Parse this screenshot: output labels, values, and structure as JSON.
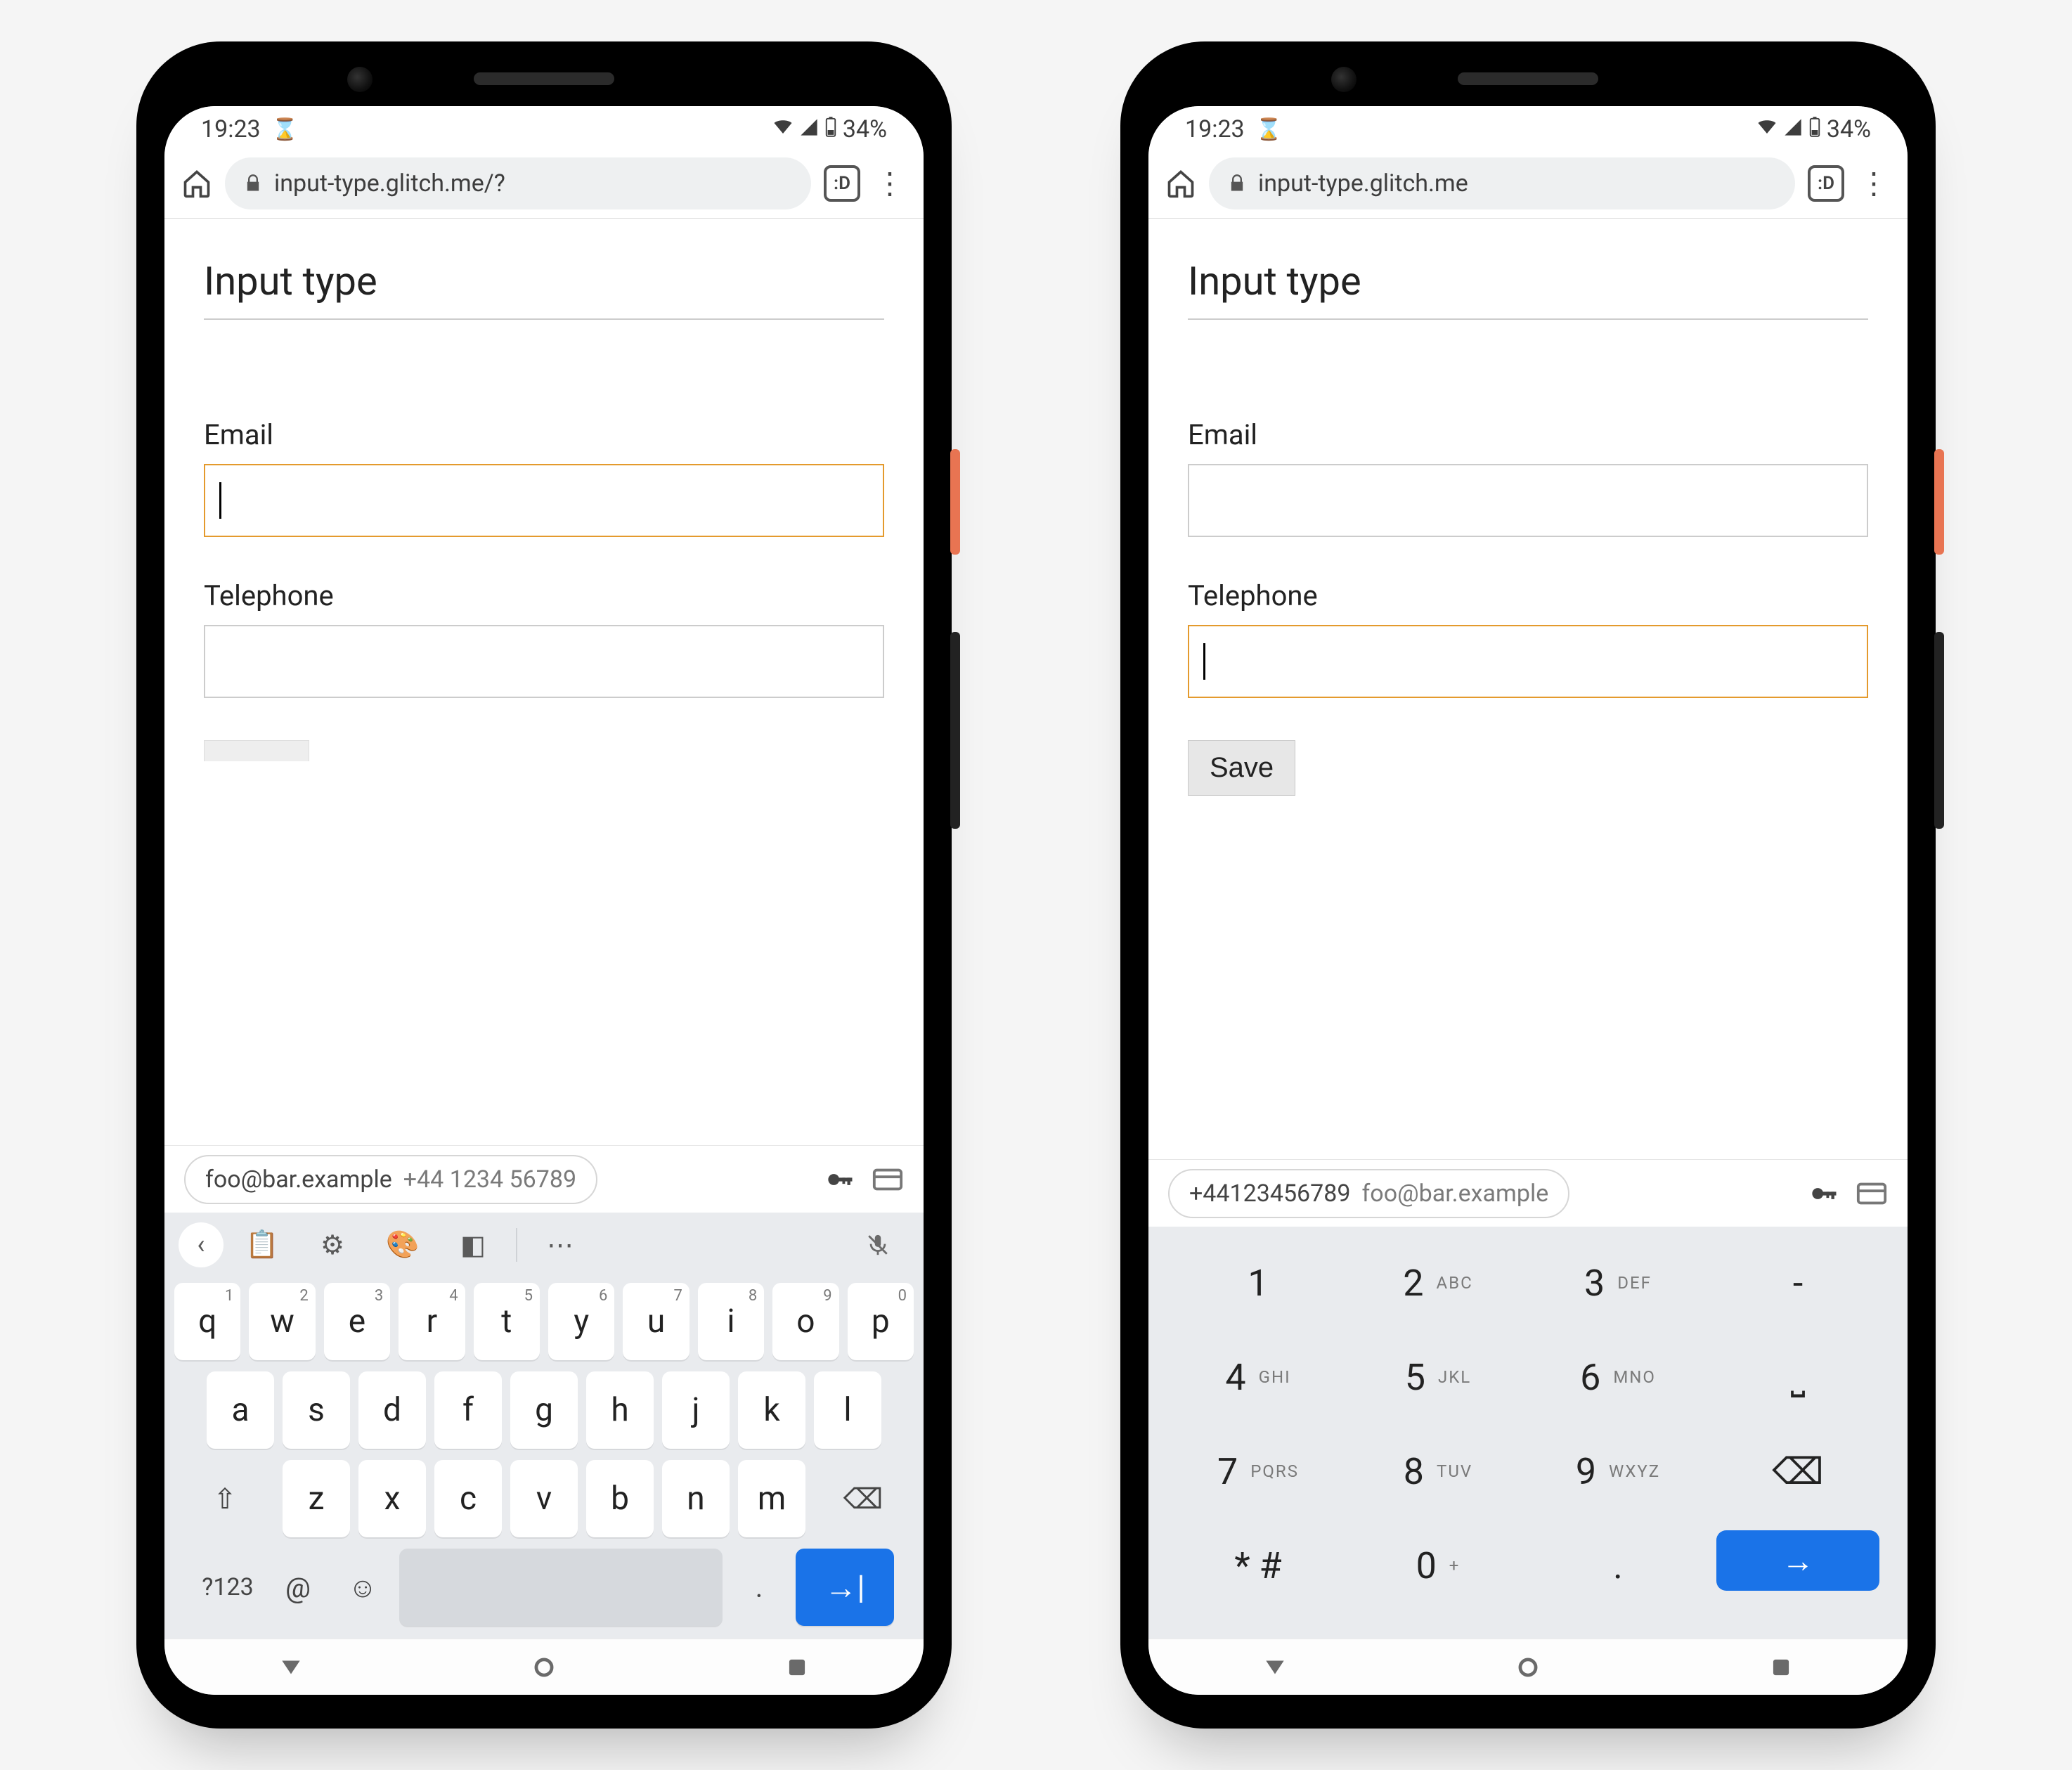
{
  "status": {
    "time": "19:23",
    "battery": "34%"
  },
  "browser": {
    "url_left": "input-type.glitch.me/?",
    "url_right": "input-type.glitch.me",
    "tab_label": ":D"
  },
  "page": {
    "title": "Input type",
    "email_label": "Email",
    "tel_label": "Telephone",
    "save_label": "Save"
  },
  "autofill": {
    "left_primary": "foo@bar.example",
    "left_secondary": "+44 1234 56789",
    "right_primary": "+44123456789",
    "right_secondary": "foo@bar.example"
  },
  "qwerty": {
    "row1": [
      {
        "k": "q",
        "n": "1"
      },
      {
        "k": "w",
        "n": "2"
      },
      {
        "k": "e",
        "n": "3"
      },
      {
        "k": "r",
        "n": "4"
      },
      {
        "k": "t",
        "n": "5"
      },
      {
        "k": "y",
        "n": "6"
      },
      {
        "k": "u",
        "n": "7"
      },
      {
        "k": "i",
        "n": "8"
      },
      {
        "k": "o",
        "n": "9"
      },
      {
        "k": "p",
        "n": "0"
      }
    ],
    "row2": [
      "a",
      "s",
      "d",
      "f",
      "g",
      "h",
      "j",
      "k",
      "l"
    ],
    "row3": [
      "z",
      "x",
      "c",
      "v",
      "b",
      "n",
      "m"
    ],
    "symkey": "?123",
    "at": "@",
    "period": "."
  },
  "numpad": {
    "rows": [
      [
        {
          "n": "1",
          "l": ""
        },
        {
          "n": "2",
          "l": "ABC"
        },
        {
          "n": "3",
          "l": "DEF"
        },
        {
          "n": "-",
          "l": ""
        }
      ],
      [
        {
          "n": "4",
          "l": "GHI"
        },
        {
          "n": "5",
          "l": "JKL"
        },
        {
          "n": "6",
          "l": "MNO"
        },
        {
          "n": "␣",
          "l": ""
        }
      ],
      [
        {
          "n": "7",
          "l": "PQRS"
        },
        {
          "n": "8",
          "l": "TUV"
        },
        {
          "n": "9",
          "l": "WXYZ"
        },
        {
          "n": "⌫",
          "l": ""
        }
      ],
      [
        {
          "n": "* #",
          "l": ""
        },
        {
          "n": "0",
          "l": "+"
        },
        {
          "n": ".",
          "l": ""
        },
        {
          "n": "→",
          "l": "",
          "action": true
        }
      ]
    ]
  }
}
